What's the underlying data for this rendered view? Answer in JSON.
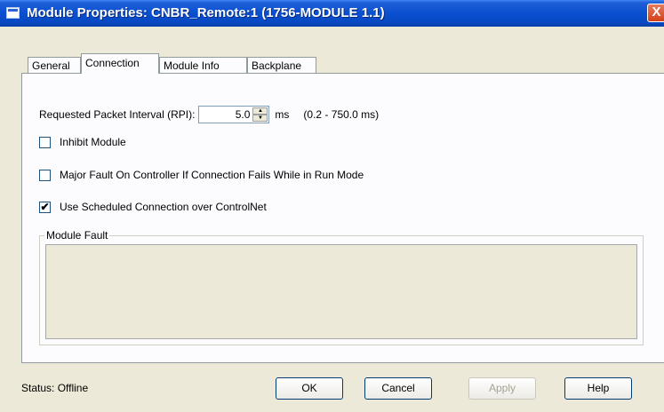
{
  "window": {
    "title": "Module Properties: CNBR_Remote:1 (1756-MODULE 1.1)",
    "close_label": "X"
  },
  "tabs": [
    {
      "label": "General"
    },
    {
      "label": "Connection"
    },
    {
      "label": "Module Info"
    },
    {
      "label": "Backplane"
    }
  ],
  "connection": {
    "rpi_label": "Requested Packet Interval (RPI):",
    "rpi_value": "5.0",
    "rpi_unit": "ms",
    "rpi_range": "(0.2 - 750.0 ms)",
    "inhibit_label": "Inhibit Module",
    "inhibit_checked": false,
    "major_fault_label": "Major Fault On Controller If Connection Fails While in Run Mode",
    "major_fault_checked": false,
    "scheduled_label": "Use Scheduled Connection over ControlNet",
    "scheduled_checked": true,
    "module_fault_label": "Module Fault"
  },
  "footer": {
    "status": "Status:  Offline",
    "ok": "OK",
    "cancel": "Cancel",
    "apply": "Apply",
    "help": "Help"
  }
}
